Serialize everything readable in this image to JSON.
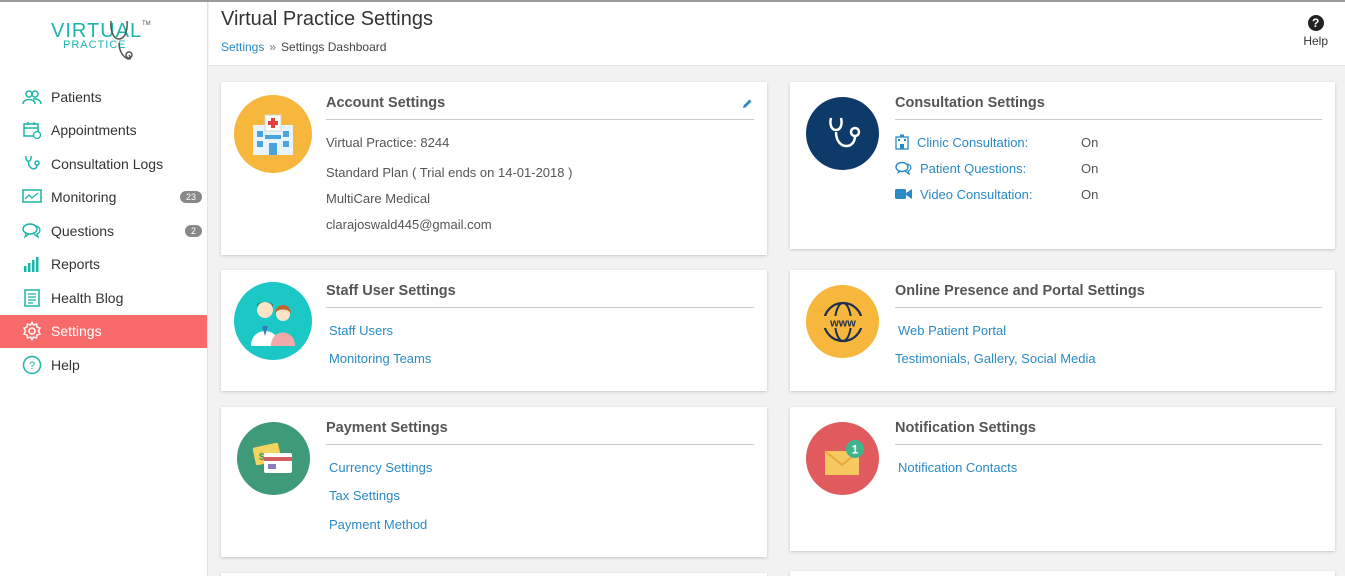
{
  "logo": {
    "line1": "VIRTUAL",
    "line2": "PRACTICE",
    "tm": "TM"
  },
  "sidebar": {
    "items": [
      {
        "label": "Patients",
        "icon": "patients-icon"
      },
      {
        "label": "Appointments",
        "icon": "calendar-icon"
      },
      {
        "label": "Consultation Logs",
        "icon": "stethoscope-icon"
      },
      {
        "label": "Monitoring",
        "icon": "monitor-chart-icon",
        "badge": "23"
      },
      {
        "label": "Questions",
        "icon": "chat-bubbles-icon",
        "badge": "2"
      },
      {
        "label": "Reports",
        "icon": "bar-chart-icon"
      },
      {
        "label": "Health Blog",
        "icon": "document-icon"
      },
      {
        "label": "Settings",
        "icon": "gear-icon",
        "active": true
      },
      {
        "label": "Help",
        "icon": "question-circle-icon"
      }
    ]
  },
  "header": {
    "title": "Virtual Practice Settings",
    "breadcrumb": {
      "link": "Settings",
      "separator": "»",
      "current": "Settings Dashboard"
    },
    "help_label": "Help",
    "help_glyph": "?"
  },
  "account": {
    "title": "Account Settings",
    "lines": [
      "Virtual Practice: 8244",
      "Standard Plan ( Trial ends on 14-01-2018 )",
      "MultiCare Medical",
      "clarajoswald445@gmail.com"
    ],
    "icon": "hospital-icon",
    "color": "#f6b73c"
  },
  "consultation": {
    "title": "Consultation Settings",
    "icon": "stethoscope-icon",
    "color": "#0e3a6a",
    "rows": [
      {
        "label": "Clinic Consultation:",
        "value": "On",
        "icon": "clinic-building-icon"
      },
      {
        "label": "Patient Questions:",
        "value": "On",
        "icon": "chat-bubbles-icon"
      },
      {
        "label": "Video Consultation:",
        "value": "On",
        "icon": "video-camera-icon"
      }
    ]
  },
  "staff": {
    "title": "Staff User Settings",
    "icon": "medical-staff-icon",
    "color": "#1bc8c6",
    "links": [
      "Staff Users",
      "Monitoring Teams"
    ]
  },
  "online": {
    "title": "Online Presence and Portal Settings",
    "icon": "globe-www-icon",
    "color": "#f6b73c",
    "globe_text": "www",
    "links": [
      "Web Patient Portal",
      "Testimonials, Gallery, Social Media"
    ]
  },
  "payment": {
    "title": "Payment Settings",
    "icon": "payment-card-icon",
    "color": "#3f9a7a",
    "links": [
      "Currency Settings",
      "Tax Settings",
      "Payment Method"
    ]
  },
  "notification": {
    "title": "Notification Settings",
    "icon": "envelope-notification-icon",
    "color": "#e05a5e",
    "badge": "1",
    "links": [
      "Notification Contacts"
    ]
  },
  "colors": {
    "accent": "#1bb5aa",
    "link": "#2a8ac6",
    "active_nav": "#f86b6b"
  }
}
